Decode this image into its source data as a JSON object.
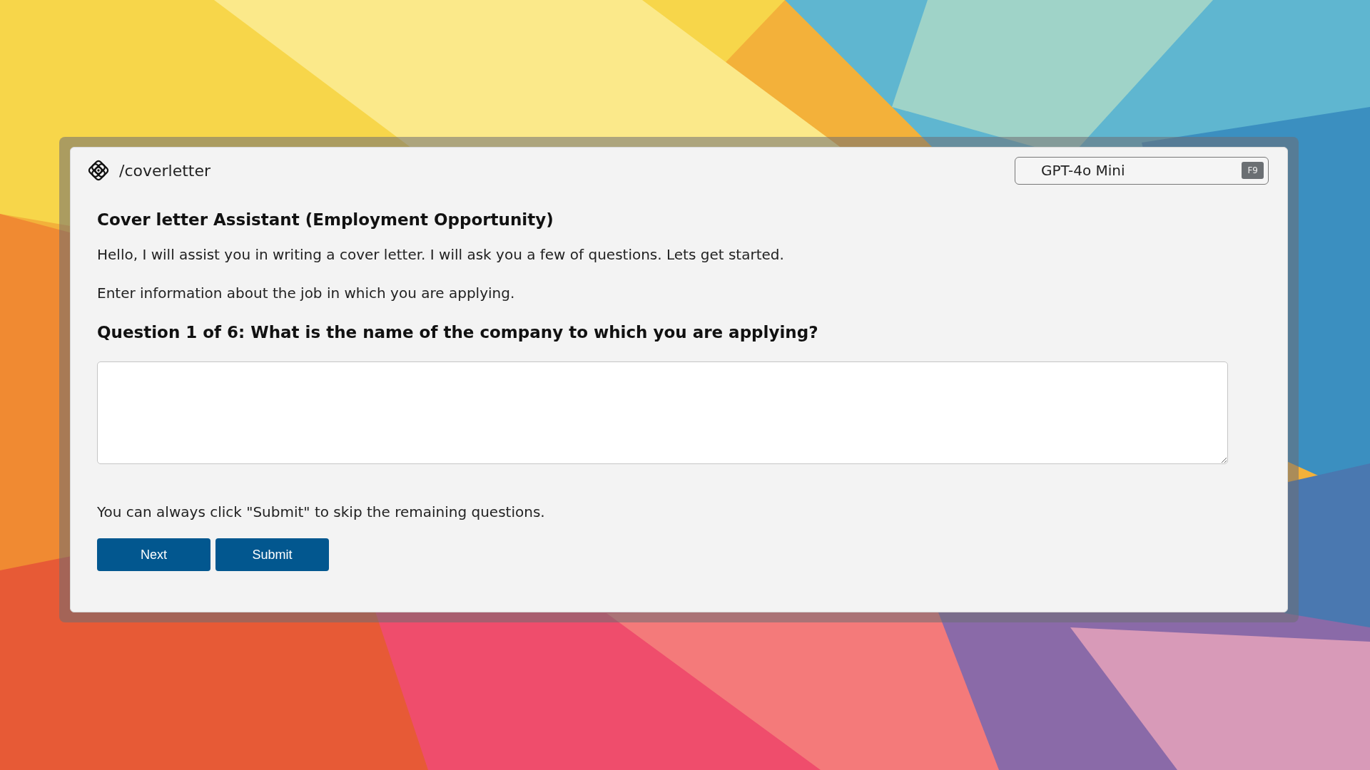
{
  "header": {
    "command": "/coverletter",
    "model": {
      "label": "GPT-4o Mini",
      "shortcut": "F9"
    }
  },
  "title": "Cover letter Assistant (Employment Opportunity)",
  "paragraphs": [
    "Hello, I will assist you in writing a cover letter. I will ask you a few of questions. Lets get started.",
    "Enter information about the job in which you are applying."
  ],
  "question": "Question 1 of 6: What is the name of the company to which you are applying?",
  "hint": "You can always click \"Submit\" to skip the remaining questions.",
  "buttons": [
    "Next",
    "Submit"
  ]
}
